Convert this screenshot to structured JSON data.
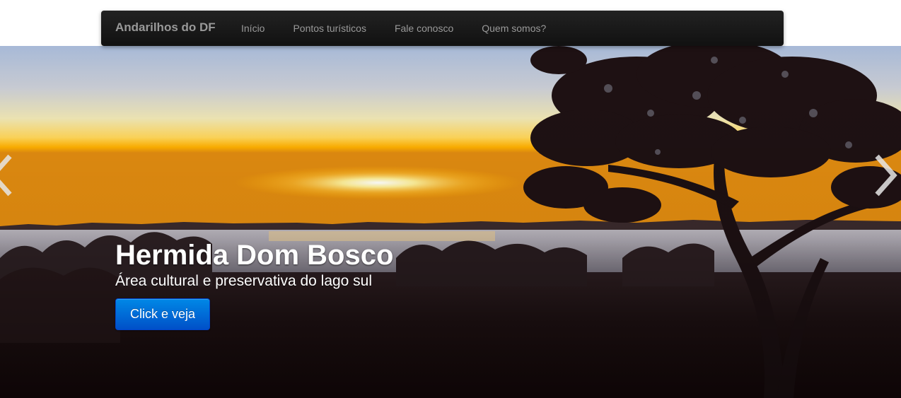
{
  "navbar": {
    "brand": "Andarilhos do DF",
    "items": [
      {
        "label": "Início"
      },
      {
        "label": "Pontos turísticos"
      },
      {
        "label": "Fale conosco"
      },
      {
        "label": "Quem somos?"
      }
    ]
  },
  "carousel": {
    "slide": {
      "title": "Hermida Dom Bosco",
      "subtitle": "Área cultural e preservativa do lago sul",
      "button_label": "Click e veja"
    },
    "prev_icon": "chevron-left-icon",
    "next_icon": "chevron-right-icon"
  },
  "colors": {
    "navbar_bg": "#1b1b1b",
    "nav_text": "#999999",
    "button_primary": "#0066d6",
    "sky_top": "#a9bcd8",
    "horizon_glow": "#ffb000"
  }
}
